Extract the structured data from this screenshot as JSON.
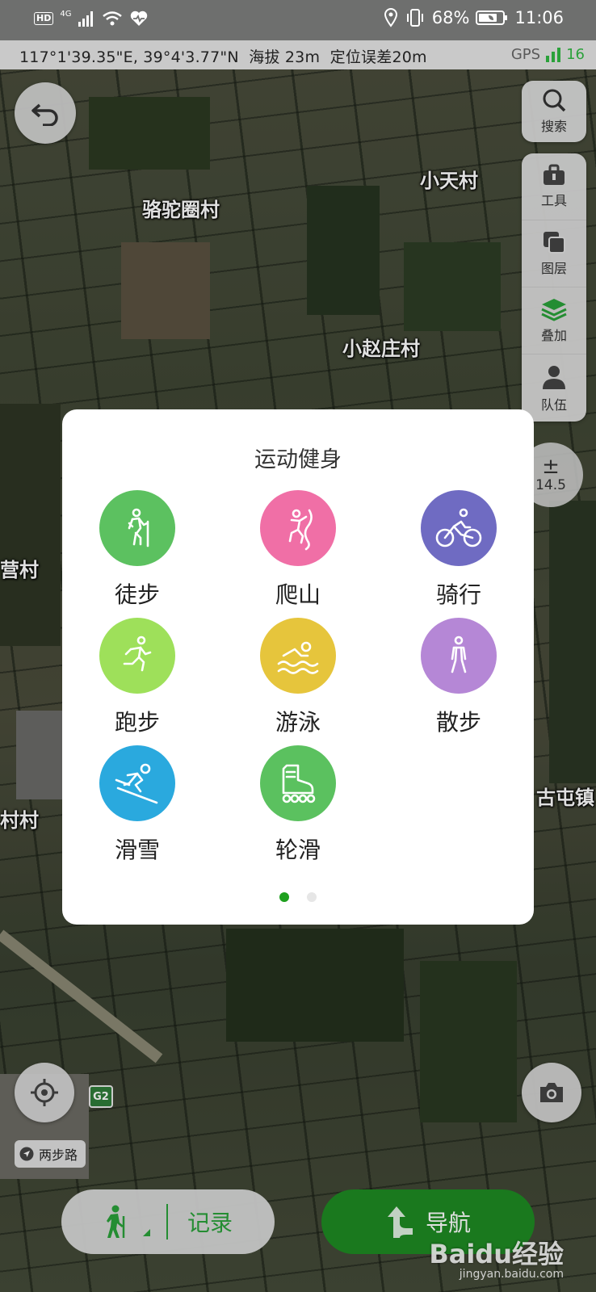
{
  "status_bar": {
    "hd": "HD",
    "network": "4G",
    "battery": "68%",
    "time": "11:06"
  },
  "coord_bar": {
    "coordinates": "117°1'39.35\"E, 39°4'3.77\"N",
    "altitude": "海拔 23m",
    "accuracy": "定位误差20m",
    "gps_label": "GPS",
    "gps_count": "16"
  },
  "map": {
    "labels": [
      "骆驼圈村",
      "小天村",
      "小赵庄村",
      "营村",
      "古屯镇",
      "村村"
    ],
    "road_sign": "G2",
    "road_name": "两步路",
    "zoom_level": "14.5"
  },
  "side_panel": {
    "search": "搜索",
    "tools": "工具",
    "layers": "图层",
    "overlay": "叠加",
    "team": "队伍"
  },
  "modal": {
    "title": "运动健身",
    "activities": [
      {
        "label": "徒步",
        "color": "#5cc160",
        "icon": "hiking-icon"
      },
      {
        "label": "爬山",
        "color": "#f06fa6",
        "icon": "climbing-icon"
      },
      {
        "label": "骑行",
        "color": "#6f6bc2",
        "icon": "cycling-icon"
      },
      {
        "label": "跑步",
        "color": "#9ee05a",
        "icon": "running-icon"
      },
      {
        "label": "游泳",
        "color": "#e6c53c",
        "icon": "swimming-icon"
      },
      {
        "label": "散步",
        "color": "#b587d6",
        "icon": "walking-icon"
      },
      {
        "label": "滑雪",
        "color": "#2aa9de",
        "icon": "skiing-icon"
      },
      {
        "label": "轮滑",
        "color": "#5bc15f",
        "icon": "rollerskate-icon"
      }
    ],
    "page_dots": {
      "active": "#1ea01e",
      "inactive": "#e6e6e6"
    }
  },
  "bottom_bar": {
    "record_label": "记录",
    "navigate_label": "导航"
  },
  "watermark": {
    "brand": "Baidu经验",
    "url": "jingyan.baidu.com"
  }
}
